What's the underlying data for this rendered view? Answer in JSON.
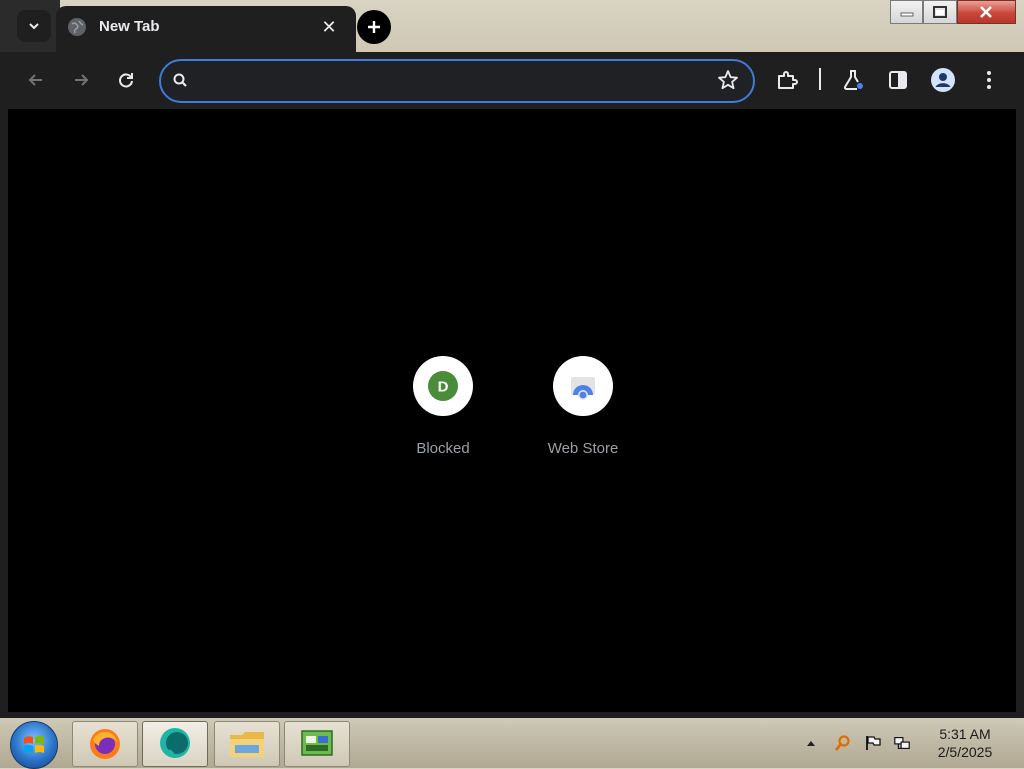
{
  "browser": {
    "tab": {
      "title": "New Tab",
      "close_glyph": "✕"
    },
    "new_tab_glyph": "+",
    "omnibox": {
      "value": "",
      "placeholder": ""
    },
    "accent_color": "#3f7bd9"
  },
  "window_controls": [
    "minimize",
    "maximize",
    "close"
  ],
  "toolbar_icons": [
    "back-icon",
    "forward-icon",
    "reload-icon",
    "bookmark-star-icon",
    "extensions-icon",
    "labs-flask-icon",
    "side-panel-icon",
    "profile-avatar-icon",
    "menu-dots-icon"
  ],
  "shortcuts": [
    {
      "label": "Blocked",
      "letter": "D",
      "icon_color": "#4a8c3a"
    },
    {
      "label": "Web Store",
      "icon": "web-store-icon"
    }
  ],
  "taskbar": {
    "apps": [
      "firefox-icon",
      "chat-app-icon",
      "file-explorer-icon",
      "network-app-icon"
    ],
    "tray_icons": [
      "show-hidden-icons-icon",
      "search-icon",
      "action-center-flag-icon",
      "network-icon"
    ],
    "time": "5:31 AM",
    "date": "2/5/2025"
  }
}
